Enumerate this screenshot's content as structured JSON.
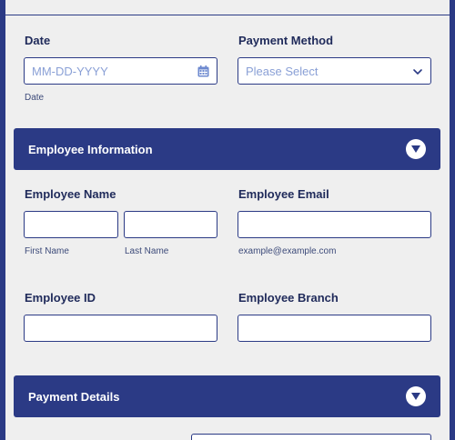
{
  "date_field": {
    "label": "Date",
    "placeholder": "MM-DD-YYYY",
    "sublabel": "Date",
    "icon": "calendar-icon"
  },
  "payment_method": {
    "label": "Payment Method",
    "selected": "Please Select",
    "icon": "chevron-down-icon"
  },
  "employee_section": {
    "title": "Employee Information",
    "toggle_icon": "collapse-icon",
    "name": {
      "label": "Employee Name",
      "first_sublabel": "First Name",
      "last_sublabel": "Last Name"
    },
    "email": {
      "label": "Employee Email",
      "sublabel": "example@example.com"
    },
    "id": {
      "label": "Employee ID"
    },
    "branch": {
      "label": "Employee Branch"
    }
  },
  "payment_section": {
    "title": "Payment Details",
    "toggle_icon": "collapse-icon"
  },
  "colors": {
    "primary": "#2b3a85",
    "background": "#efefef",
    "placeholder": "#8aa0d6"
  }
}
